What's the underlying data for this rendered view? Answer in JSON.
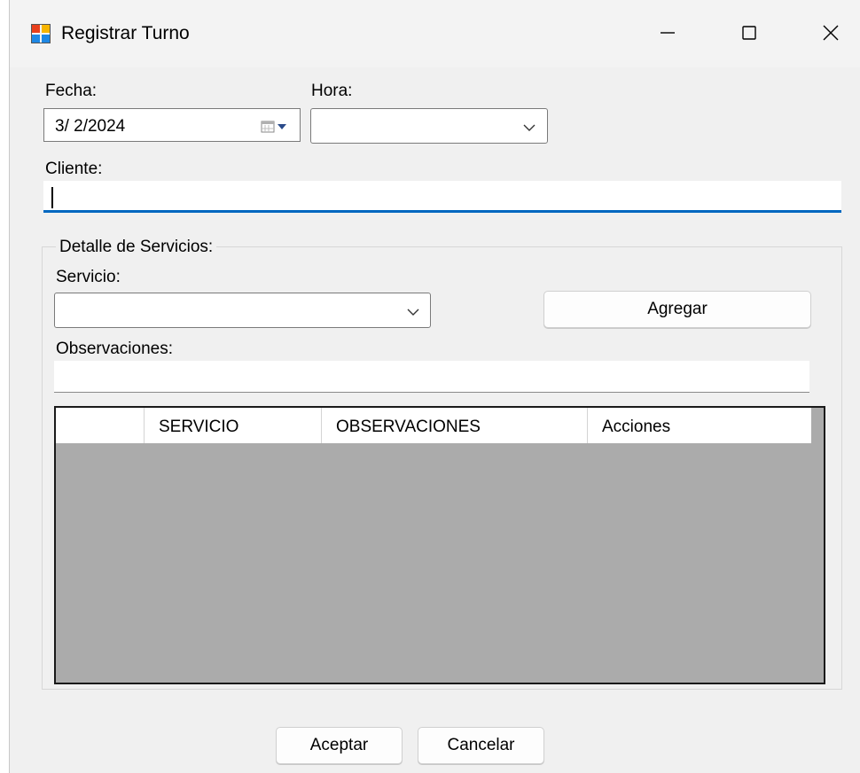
{
  "window": {
    "title": "Registrar Turno",
    "controls": [
      "minimize-icon",
      "maximize-icon",
      "close-icon"
    ]
  },
  "form": {
    "fecha_label": "Fecha:",
    "fecha_value": "3/  2/2024",
    "hora_label": "Hora:",
    "hora_value": "",
    "cliente_label": "Cliente:",
    "cliente_value": ""
  },
  "detalle": {
    "group_title": "Detalle de Servicios:",
    "servicio_label": "Servicio:",
    "servicio_value": "",
    "agregar_label": "Agregar",
    "observaciones_label": "Observaciones:",
    "observaciones_value": ""
  },
  "grid": {
    "columns": [
      "",
      "SERVICIO",
      "OBSERVACIONES",
      "Acciones"
    ],
    "rows": []
  },
  "footer": {
    "aceptar_label": "Aceptar",
    "cancelar_label": "Cancelar"
  },
  "colors": {
    "window_bg": "#f0f0f0",
    "focus_underline": "#0067c0",
    "grid_bg": "#ababab"
  }
}
